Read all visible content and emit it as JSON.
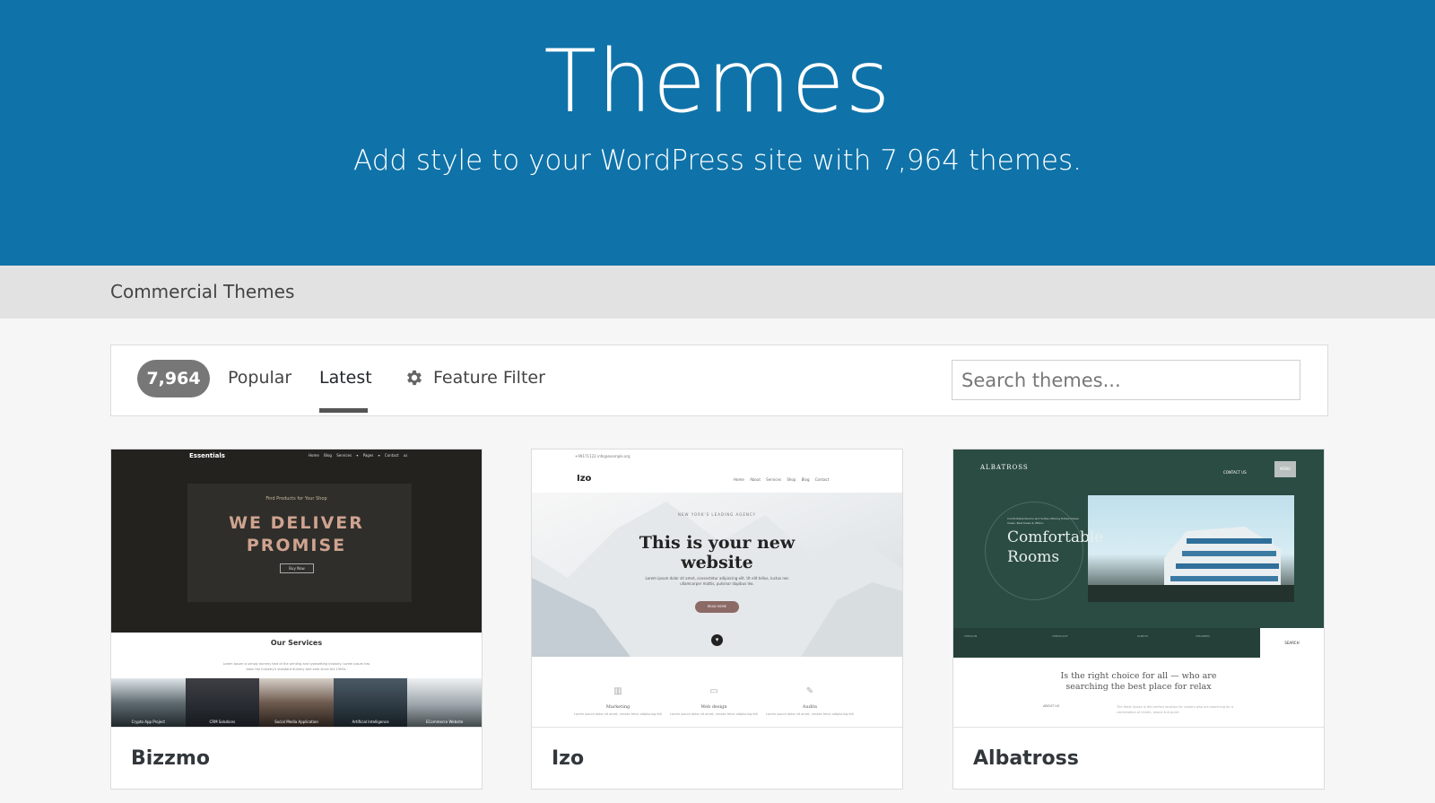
{
  "hero": {
    "title": "Themes",
    "subtitle": "Add style to your WordPress site with 7,964 themes.",
    "background": "#0f73a9"
  },
  "subnav": {
    "title": "Commercial Themes"
  },
  "filter_bar": {
    "count": "7,964",
    "tabs": [
      {
        "label": "Popular",
        "active": false
      },
      {
        "label": "Latest",
        "active": true
      }
    ],
    "feature_filter": {
      "label": "Feature Filter",
      "icon": "gear-icon"
    },
    "search": {
      "placeholder": "Search themes..."
    }
  },
  "themes": [
    {
      "name": "Bizzmo",
      "preview": {
        "logo": "Essentials",
        "nav": "Home  Blog  Services ▾  Pages ▾  Contact us",
        "kicker": "Find Products for Your Shop",
        "headline_1": "WE DELIVER",
        "headline_2": "PROMISE",
        "button": "Buy Now",
        "section_title": "Our Services",
        "section_text": "Lorem ipsum is simply dummy text of the printing and typesetting industry. Lorem ipsum has been the industry's standard dummy text ever since the 1500s.",
        "services": [
          "Crypto App Project",
          "CRM Solutions",
          "Social Media Application",
          "Artificial Intelligence",
          "ECommerce Website"
        ]
      }
    },
    {
      "name": "Izo",
      "preview": {
        "topbar": "+99171122   info@example.org",
        "logo": "Izo",
        "nav": "Home  About  Services  Shop  Blog  Contact",
        "kicker": "NEW YORK'S LEADING AGENCY",
        "headline_1": "This is your new",
        "headline_2": "website",
        "text": "Lorem ipsum dolor sit amet, consectetur adipiscing elit. Ut elit tellus, luctus nec ullamcorper mattis, pulvinar dapibus leo.",
        "button": "READ MORE",
        "features": [
          {
            "icon": "chart-icon",
            "title": "Marketing",
            "text": "Lorem ipsum dolor sit amet, consec tetur adipiscing elit"
          },
          {
            "icon": "monitor-icon",
            "title": "Web design",
            "text": "Lorem ipsum dolor sit amet, consec tetur adipiscing elit"
          },
          {
            "icon": "edit-icon",
            "title": "Audits",
            "text": "Lorem ipsum dolor sit amet, consec tetur adipiscing elit"
          }
        ]
      }
    },
    {
      "name": "Albatross",
      "preview": {
        "logo": "ALBATROSS",
        "contact": "CONTACT US",
        "menu": "MENU",
        "small_text": "Comfortable Rooms and Suites offering Hotels Ocean Views. Best Deals & Offers.",
        "headline_1": "Comfortable",
        "headline_2": "Rooms",
        "booking_fields": [
          "CHECK-IN",
          "CHECK-OUT",
          "GUESTS",
          "CHILDREN"
        ],
        "search": "SEARCH",
        "tagline_1": "Is the right choice for all — who are",
        "tagline_2": "searching the best place for relax",
        "mini_label": "ABOUT US",
        "mini_text": "The Hotel Space is the perfect location for visitors who are searching for a combination of charm, peace and quiet."
      }
    }
  ]
}
